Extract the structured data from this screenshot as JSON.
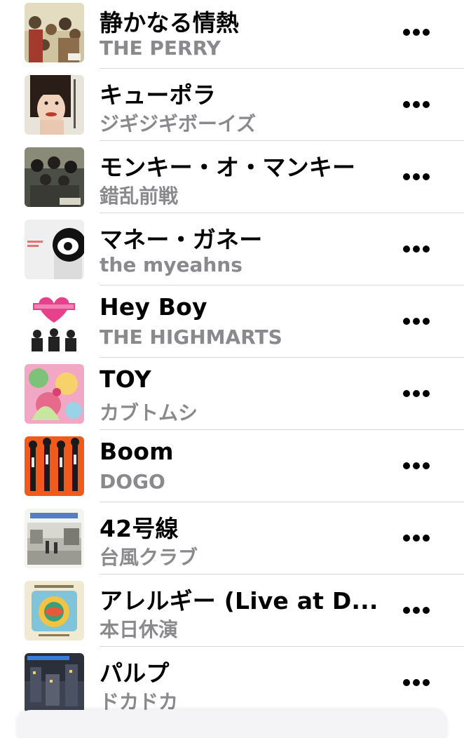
{
  "songs": [
    {
      "title": "静かなる情熱",
      "artist": "THE PERRY",
      "artwork": "band-photo-artwork"
    },
    {
      "title": "キューポラ",
      "artist": "ジギジギボーイズ",
      "artwork": "portrait-artwork"
    },
    {
      "title": "モンキー・オ・マンキー",
      "artist": "錯乱前戦",
      "artwork": "band-photo-artwork"
    },
    {
      "title": "マネー・ガネー",
      "artist": "the myeahns",
      "artwork": "symbol-faces-artwork"
    },
    {
      "title": "Hey Boy",
      "artist": "THE HIGHMARTS",
      "artwork": "heart-logo-artwork"
    },
    {
      "title": "TOY",
      "artist": "カブトムシ",
      "artwork": "pink-pattern-artwork"
    },
    {
      "title": "Boom",
      "artist": "DOGO",
      "artwork": "orange-figures-artwork"
    },
    {
      "title": "42号線",
      "artist": "台風クラブ",
      "artwork": "street-photo-artwork"
    },
    {
      "title": "アレルギー (Live at D...",
      "artist": "本日休演",
      "artwork": "illustration-artwork"
    },
    {
      "title": "パルプ",
      "artist": "ドカドカ",
      "artwork": "night-city-artwork"
    }
  ],
  "more_icon": "ellipsis-icon",
  "colors": {
    "title": "#000000",
    "subtitle": "#8a8a8e",
    "separator": "#d8d8d8"
  }
}
